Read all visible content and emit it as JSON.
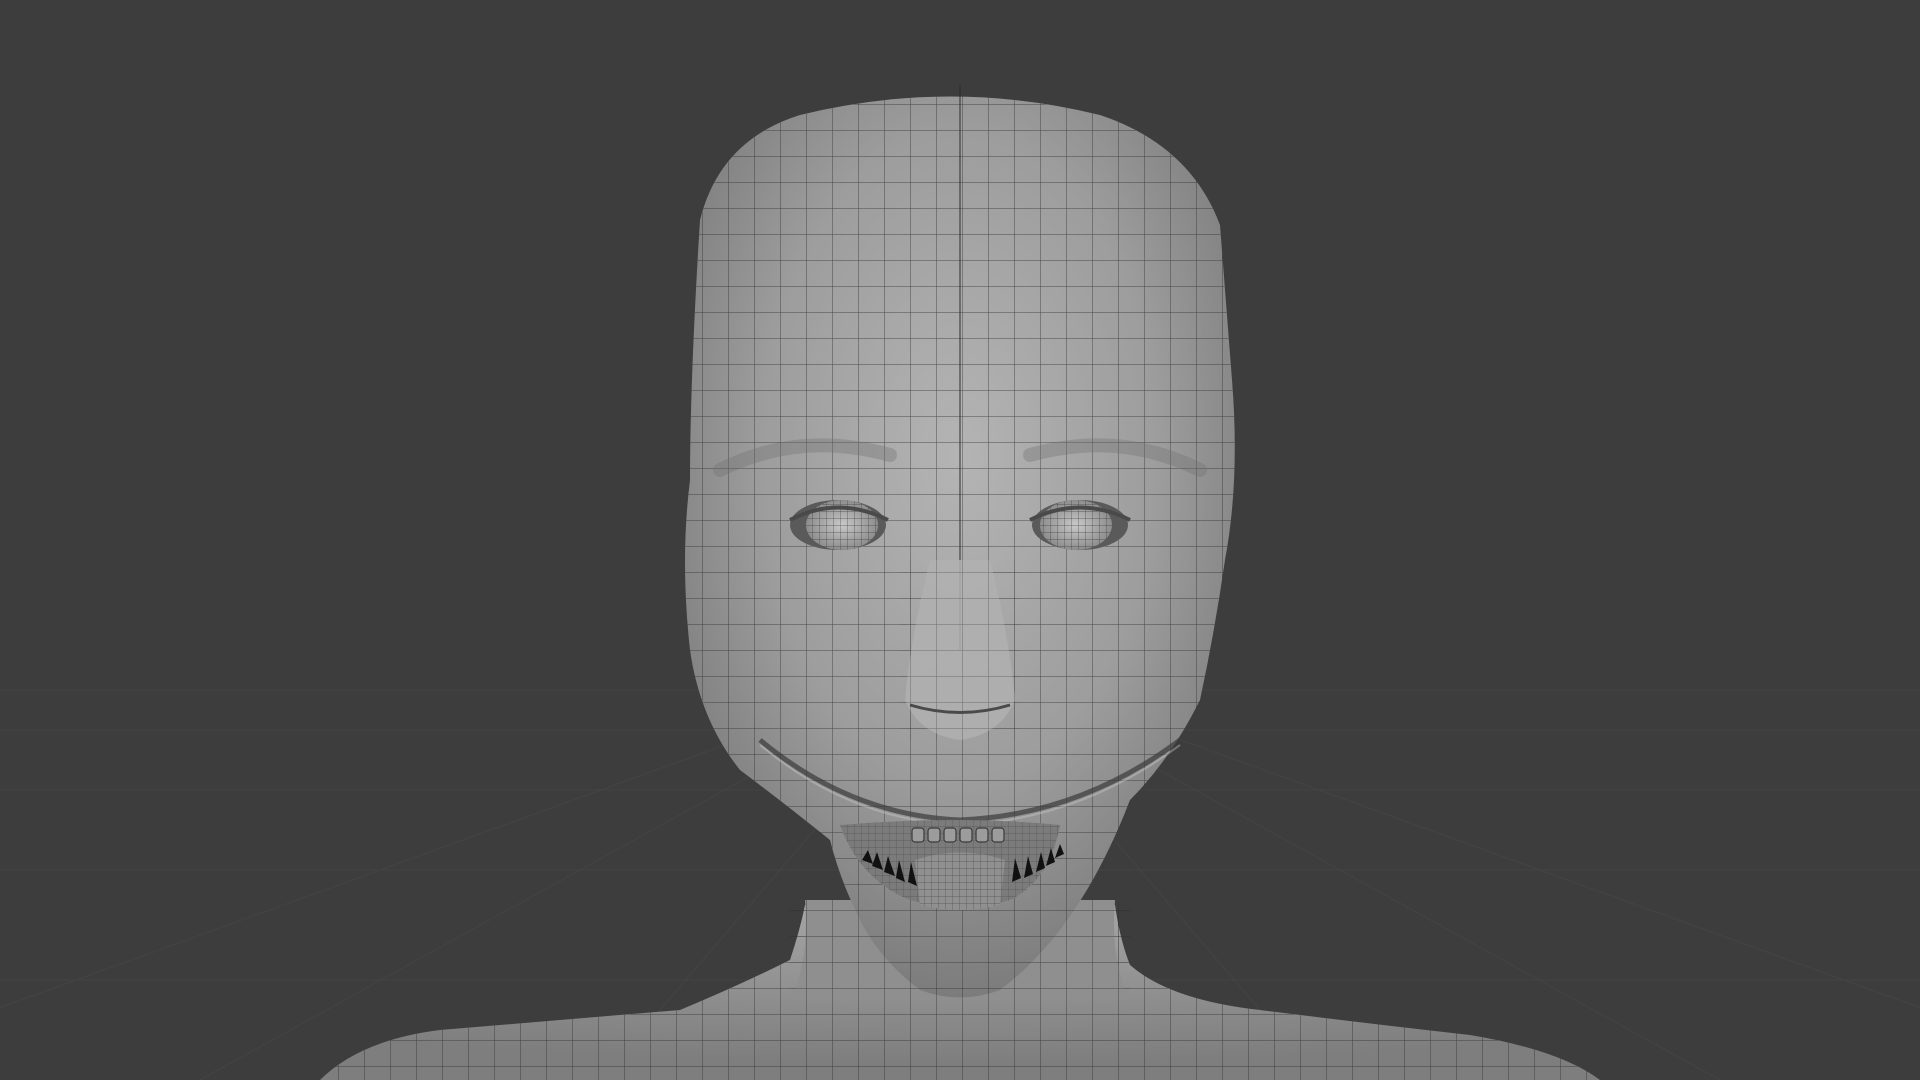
{
  "viewport": {
    "background": "#3d3d3d",
    "grid_color": "#4a4a4a",
    "mesh_fill": "#9a9a9a",
    "mesh_wire": "#2b2b2b",
    "teeth_color": "#111111"
  },
  "scene": {
    "object": "head-mesh",
    "shading": "solid",
    "wireframe_overlay": true
  }
}
